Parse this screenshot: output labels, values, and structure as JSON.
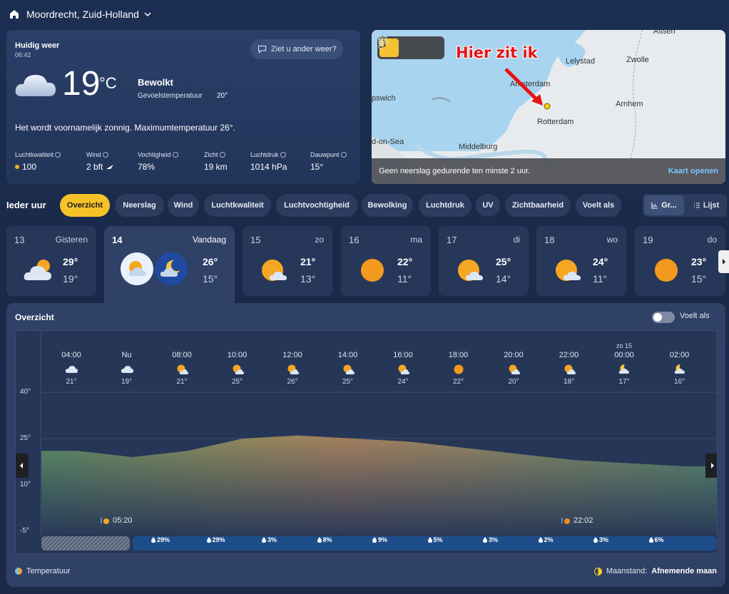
{
  "header": {
    "location": "Moordrecht, Zuid-Holland"
  },
  "current": {
    "title": "Huidig weer",
    "time": "06:42",
    "feedback_label": "Ziet u ander weer?",
    "temp": "19",
    "unit": "°C",
    "condition": "Bewolkt",
    "feels_label": "Gevoelstemperatuur",
    "feels_value": "20°",
    "description": "Het wordt voornamelijk zonnig. Maximumtemperatuur 26°.",
    "metrics": [
      {
        "label": "Luchtkwaliteit",
        "value": "100"
      },
      {
        "label": "Wind",
        "value": "2 bft"
      },
      {
        "label": "Vochtigheid",
        "value": "78%"
      },
      {
        "label": "Zicht",
        "value": "19 km"
      },
      {
        "label": "Luchtdruk",
        "value": "1014 hPa"
      },
      {
        "label": "Dauwpunt",
        "value": "15°"
      }
    ]
  },
  "map": {
    "annotation": "Hier zit ik",
    "cities": [
      "Assen",
      "Lelystad",
      "Zwolle",
      "Amsterdam",
      "Arnhem",
      "pswich",
      "Rotterdam",
      "d-on-Sea",
      "Middelburg"
    ],
    "status": "Geen neerslag gedurende ten minste 2 uur.",
    "open_label": "Kaart openen"
  },
  "hourly": {
    "heading": "Ieder uur",
    "tabs": [
      "Overzicht",
      "Neerslag",
      "Wind",
      "Luchtkwaliteit",
      "Luchtvochtigheid",
      "Bewolking",
      "Luchtdruk",
      "UV",
      "Zichtbaarheid",
      "Voelt als"
    ],
    "view_graph": "Gr...",
    "view_list": "Lijst"
  },
  "days": [
    {
      "num": "13",
      "name": "Gisteren",
      "hi": "29°",
      "lo": "19°",
      "icon": "partly-sunny-icon"
    },
    {
      "num": "14",
      "name": "Vandaag",
      "hi": "26°",
      "lo": "15°",
      "icon": "sun-cloud-and-moon-icon"
    },
    {
      "num": "15",
      "name": "zo",
      "hi": "21°",
      "lo": "13°",
      "icon": "sun-cloud-icon"
    },
    {
      "num": "16",
      "name": "ma",
      "hi": "22°",
      "lo": "11°",
      "icon": "sun-icon"
    },
    {
      "num": "17",
      "name": "di",
      "hi": "25°",
      "lo": "14°",
      "icon": "sun-cloud-icon"
    },
    {
      "num": "18",
      "name": "wo",
      "hi": "24°",
      "lo": "11°",
      "icon": "sun-cloud-icon"
    },
    {
      "num": "19",
      "name": "do",
      "hi": "23°",
      "lo": "15°",
      "icon": "sun-icon"
    }
  ],
  "overview": {
    "title": "Overzicht",
    "toggle_label": "Voelt als",
    "y_ticks": [
      "40°",
      "25°",
      "10°",
      "-5°"
    ],
    "hours": [
      {
        "time": "04:00",
        "temp": "21°",
        "icon": "cloud"
      },
      {
        "time": "Nu",
        "temp": "19°",
        "icon": "cloud"
      },
      {
        "time": "08:00",
        "temp": "21°",
        "icon": "sun-cloud"
      },
      {
        "time": "10:00",
        "temp": "25°",
        "icon": "sun-cloud"
      },
      {
        "time": "12:00",
        "temp": "26°",
        "icon": "sun-cloud"
      },
      {
        "time": "14:00",
        "temp": "25°",
        "icon": "sun-cloud"
      },
      {
        "time": "16:00",
        "temp": "24°",
        "icon": "sun-cloud"
      },
      {
        "time": "18:00",
        "temp": "22°",
        "icon": "sun"
      },
      {
        "time": "20:00",
        "temp": "20°",
        "icon": "sun-cloud"
      },
      {
        "time": "22:00",
        "temp": "18°",
        "icon": "sun-cloud"
      },
      {
        "time": "00:00",
        "day": "zo 15",
        "temp": "17°",
        "icon": "moon-cloud"
      },
      {
        "time": "02:00",
        "temp": "16°",
        "icon": "moon-cloud"
      }
    ],
    "sunrise": "05:20",
    "sunset": "22:02",
    "precip": [
      "29%",
      "29%",
      "3%",
      "8%",
      "9%",
      "5%",
      "3%",
      "2%",
      "3%",
      "6%"
    ],
    "legend": "Temperatuur",
    "moon_label": "Maanstand:",
    "moon_value": "Afnemende maan"
  },
  "chart_data": {
    "type": "area",
    "x": [
      "04:00",
      "Nu",
      "08:00",
      "10:00",
      "12:00",
      "14:00",
      "16:00",
      "18:00",
      "20:00",
      "22:00",
      "00:00",
      "02:00"
    ],
    "series": [
      {
        "values": [
          21,
          19,
          21,
          25,
          26,
          25,
          24,
          22,
          20,
          18,
          17,
          16
        ]
      }
    ],
    "ylim": [
      -5,
      40
    ],
    "y_ticks": [
      "40°",
      "25°",
      "10°",
      "-5°"
    ]
  },
  "colors": {
    "accent": "#f6c229",
    "panel": "#2f4166",
    "background": "#1c2e52"
  }
}
